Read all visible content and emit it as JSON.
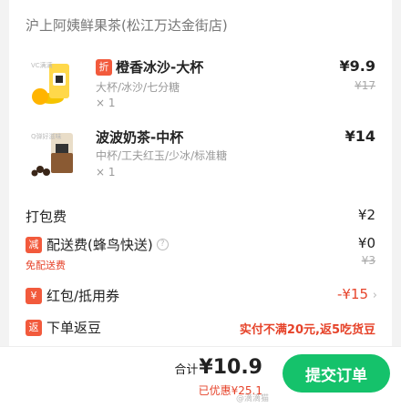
{
  "shop": {
    "name": "沪上阿姨鲜果茶(松江万达金街店)"
  },
  "items": [
    {
      "tag": "折",
      "title": "橙香冰沙-大杯",
      "spec": "大杯/冰沙/七分糖",
      "qty": "× 1",
      "price": "¥9.9",
      "orig_price": "¥17",
      "img_text": "VC满满"
    },
    {
      "title": "波波奶茶-中杯",
      "spec": "中杯/工夫红玉/少冰/标准糖",
      "qty": "× 1",
      "price": "¥14",
      "img_text": "Q弹好滋味"
    }
  ],
  "fees": {
    "packing_label": "打包费",
    "packing_value": "¥2",
    "delivery_icon": "减",
    "delivery_label": "配送费(蜂鸟快送)",
    "delivery_value": "¥0",
    "delivery_orig": "¥3",
    "delivery_note": "免配送费",
    "coupon_icon": "¥",
    "coupon_label": "红包/抵用券",
    "coupon_value": "-¥15",
    "beans_icon": "返",
    "beans_label": "下单返豆",
    "beans_value": "实付不满20元,返5吃货豆"
  },
  "footer": {
    "total_label": "合计",
    "total_value": "¥10.9",
    "saved": "已优惠¥25.1",
    "submit": "提交订单",
    "watermark": "@滴滴猫"
  },
  "colors": {
    "accent_green": "#15c26b",
    "accent_red": "#e6432a",
    "tag_orange": "#f25a3c"
  }
}
